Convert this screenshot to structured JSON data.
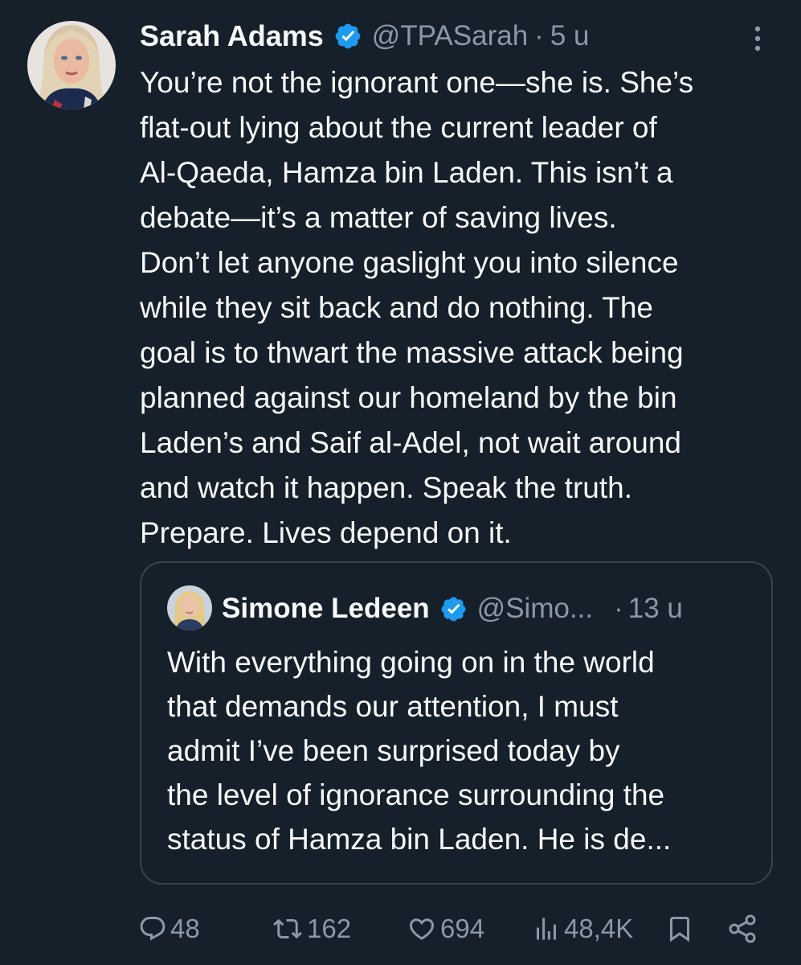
{
  "tweet": {
    "author_name": "Sarah Adams",
    "handle": "@TPASarah",
    "separator": "·",
    "time": "5 u",
    "lines": [
      "You’re not the ignorant one—she is. She’s",
      "flat-out lying about the current leader of",
      "Al-Qaeda, Hamza bin Laden. This isn’t a",
      "debate—it’s a matter of saving lives.",
      "Don’t let anyone gaslight you into silence",
      "while they sit back and do nothing. The",
      "goal is to thwart the massive attack being",
      "planned against our homeland by the bin",
      "Laden’s and Saif al-Adel, not wait around",
      "and watch it happen. Speak the truth.",
      "Prepare. Lives depend on it."
    ]
  },
  "quoted_tweet": {
    "author_name": "Simone Ledeen",
    "handle": "@Simo...",
    "separator": "·",
    "time": "13 u",
    "lines": [
      "With everything going on in the world",
      "that demands our attention, I must",
      "admit I’ve been surprised today by",
      "the level of ignorance surrounding the",
      "status of Hamza bin Laden. He is de..."
    ]
  },
  "actions": {
    "replies": "48",
    "reposts": "162",
    "likes": "694",
    "views": "48,4K"
  },
  "icons": {
    "verified": "verified-badge-icon",
    "more": "more-options-icon",
    "reply": "reply-icon",
    "repost": "repost-icon",
    "like": "heart-icon",
    "views": "views-icon",
    "bookmark": "bookmark-icon",
    "share": "share-icon"
  },
  "colors": {
    "background": "#15202b",
    "text": "#f7f9f9",
    "muted": "#8b98a5",
    "verified": "#1d9bf0",
    "border": "#38444d"
  }
}
